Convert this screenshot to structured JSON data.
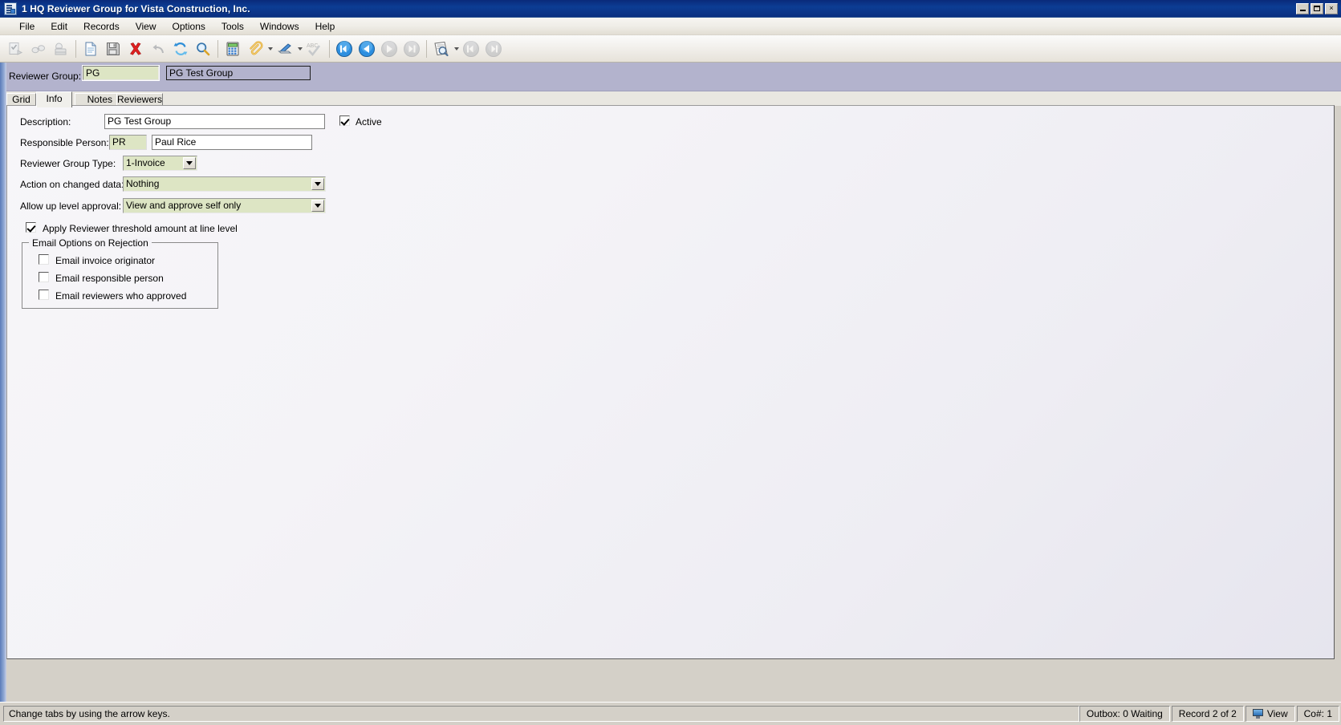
{
  "window": {
    "title": "1 HQ Reviewer Group for Vista Construction, Inc.",
    "icon": "application-window-icon",
    "controls": {
      "minimize": "minimize-icon",
      "maximize": "maximize-icon",
      "close": "×"
    }
  },
  "menubar": {
    "items": [
      {
        "label": "File"
      },
      {
        "label": "Edit"
      },
      {
        "label": "Records"
      },
      {
        "label": "View"
      },
      {
        "label": "Options"
      },
      {
        "label": "Tools"
      },
      {
        "label": "Windows"
      },
      {
        "label": "Help"
      }
    ]
  },
  "toolbar": {
    "buttons": [
      {
        "name": "check-form-icon",
        "enabled": false
      },
      {
        "name": "binoculars-icon",
        "enabled": false
      },
      {
        "name": "stamp-icon",
        "enabled": false
      },
      {
        "name": "new-record-icon",
        "enabled": true
      },
      {
        "name": "save-icon",
        "enabled": true
      },
      {
        "name": "delete-icon",
        "enabled": true
      },
      {
        "name": "undo-icon",
        "enabled": false
      },
      {
        "name": "refresh-icon",
        "enabled": true
      },
      {
        "name": "find-icon",
        "enabled": true
      },
      {
        "name": "calculator-icon",
        "enabled": true
      },
      {
        "name": "attachment-icon",
        "enabled": true
      },
      {
        "name": "attachment-dropdown-icon",
        "enabled": true
      },
      {
        "name": "scanner-icon",
        "enabled": true
      },
      {
        "name": "scanner-dropdown-icon",
        "enabled": true
      },
      {
        "name": "spellcheck-icon",
        "enabled": false
      },
      {
        "name": "first-record-icon",
        "enabled": true
      },
      {
        "name": "previous-record-icon",
        "enabled": true
      },
      {
        "name": "next-record-icon",
        "enabled": false
      },
      {
        "name": "last-record-icon",
        "enabled": false
      },
      {
        "name": "preview-icon",
        "enabled": true
      },
      {
        "name": "preview-dropdown-icon",
        "enabled": true
      },
      {
        "name": "back-icon",
        "enabled": false
      },
      {
        "name": "forward-icon",
        "enabled": false
      }
    ]
  },
  "header": {
    "label": "Reviewer Group:",
    "code_value": "PG",
    "description_value": "PG Test Group"
  },
  "tabs": [
    {
      "label": "Grid",
      "active": false
    },
    {
      "label": "Info",
      "active": true
    },
    {
      "label": "Notes",
      "active": false
    },
    {
      "label": "Reviewers",
      "active": false
    }
  ],
  "form": {
    "description": {
      "label": "Description:",
      "value": "PG Test Group"
    },
    "active": {
      "label": "Active",
      "checked": true
    },
    "responsible_person": {
      "label": "Responsible  Person:",
      "code": "PR",
      "name": "Paul Rice"
    },
    "reviewer_group_type": {
      "label": "Reviewer Group Type:",
      "value": "1-Invoice"
    },
    "action_on_changed_data": {
      "label": "Action on changed data:",
      "value": "Nothing"
    },
    "allow_up_level_approval": {
      "label": "Allow up level approval:",
      "value": "View and approve self only"
    },
    "apply_threshold": {
      "label": "Apply Reviewer threshold amount at line level",
      "checked": true
    },
    "email_options": {
      "title": "Email Options on Rejection",
      "items": [
        {
          "label": "Email invoice originator",
          "checked": false
        },
        {
          "label": "Email responsible person",
          "checked": false
        },
        {
          "label": "Email reviewers who approved",
          "checked": false
        }
      ]
    }
  },
  "statusbar": {
    "message": "Change tabs by using the arrow keys.",
    "outbox": "Outbox: 0 Waiting",
    "record": "Record 2 of 2",
    "view": "View",
    "company": "Co#: 1"
  },
  "colors": {
    "titlebar": "#0c3d94",
    "band": "#b3b3cd",
    "field_green": "#dde5c4",
    "chrome": "#d4d0c8"
  }
}
